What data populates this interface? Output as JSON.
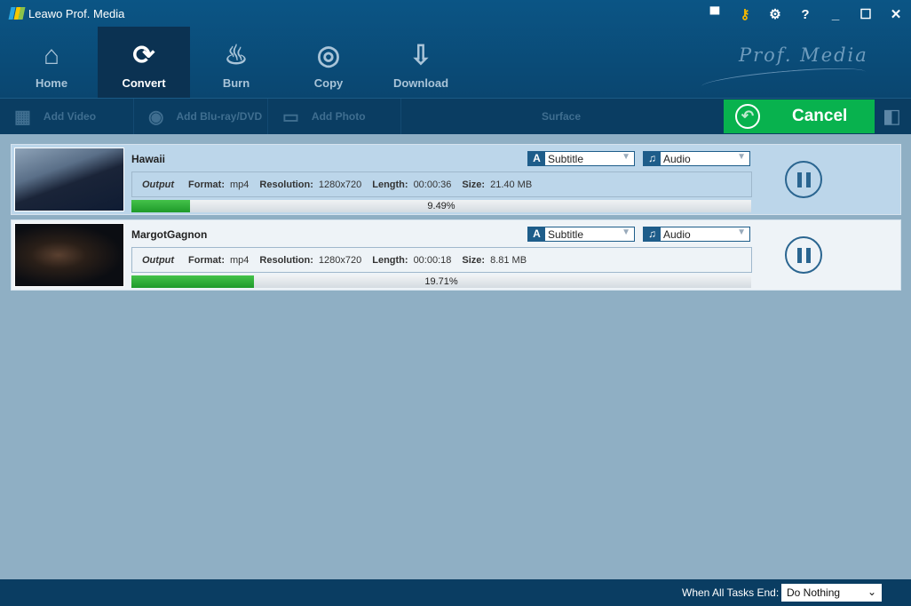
{
  "window": {
    "title": "Leawo Prof. Media",
    "brand": "Prof. Media"
  },
  "nav": [
    {
      "label": "Home",
      "icon": "home-icon"
    },
    {
      "label": "Convert",
      "icon": "convert-icon",
      "active": true
    },
    {
      "label": "Burn",
      "icon": "flame-icon"
    },
    {
      "label": "Copy",
      "icon": "disc-icon"
    },
    {
      "label": "Download",
      "icon": "download-icon"
    }
  ],
  "toolbar": {
    "add_video": "Add Video",
    "add_bluray": "Add Blu-ray/DVD",
    "add_photo": "Add Photo",
    "surface": "Surface",
    "cancel": "Cancel"
  },
  "tasks": [
    {
      "name": "Hawaii",
      "subtitle": "Subtitle",
      "audio": "Audio",
      "output": "Output",
      "format_label": "Format:",
      "format": "mp4",
      "res_label": "Resolution:",
      "resolution": "1280x720",
      "len_label": "Length:",
      "length": "00:00:36",
      "size_label": "Size:",
      "size": "21.40 MB",
      "progress": 9.49,
      "progress_text": "9.49%"
    },
    {
      "name": "MargotGagnon",
      "subtitle": "Subtitle",
      "audio": "Audio",
      "output": "Output",
      "format_label": "Format:",
      "format": "mp4",
      "res_label": "Resolution:",
      "resolution": "1280x720",
      "len_label": "Length:",
      "length": "00:00:18",
      "size_label": "Size:",
      "size": "8.81 MB",
      "progress": 19.71,
      "progress_text": "19.71%"
    }
  ],
  "status": {
    "label": "When All Tasks End:",
    "option": "Do Nothing"
  },
  "colors": {
    "accent": "#08b24e",
    "header": "#0b5585"
  }
}
